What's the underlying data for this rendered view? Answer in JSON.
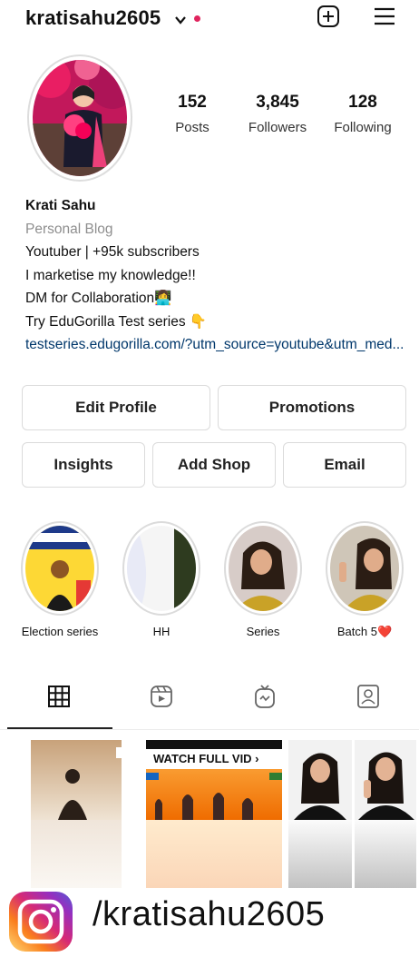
{
  "header": {
    "username": "kratisahu2605",
    "notification_dot_color": "#e0245e",
    "icons": [
      "chevron-down-icon",
      "new-post-icon",
      "menu-icon"
    ]
  },
  "stats": [
    {
      "value": "152",
      "label": "Posts"
    },
    {
      "value": "3,845",
      "label": "Followers"
    },
    {
      "value": "128",
      "label": "Following"
    }
  ],
  "bio": {
    "name": "Krati Sahu",
    "category": "Personal Blog",
    "lines": [
      "Youtuber | +95k subscribers",
      "I marketise my knowledge!!",
      "DM for Collaboration👩‍💻",
      "Try EduGorilla Test series 👇"
    ],
    "link": "testseries.edugorilla.com/?utm_source=youtube&utm_med..."
  },
  "actions": {
    "edit_profile": "Edit Profile",
    "promotions": "Promotions",
    "insights": "Insights",
    "add_shop": "Add Shop",
    "email": "Email"
  },
  "highlights": [
    {
      "label": "Election series"
    },
    {
      "label": "HH"
    },
    {
      "label": "Series"
    },
    {
      "label": "Batch 5❤️"
    }
  ],
  "tabs": [
    "grid-icon",
    "reels-icon",
    "igtv-icon",
    "tagged-icon"
  ],
  "posts": [
    {
      "thumb": "silhouette"
    },
    {
      "thumb": "video",
      "banner": "WATCH FULL VID ›"
    },
    {
      "thumb": "portrait"
    },
    {
      "thumb": "portrait"
    }
  ],
  "watermark": {
    "handle": "/kratisahu2605"
  }
}
